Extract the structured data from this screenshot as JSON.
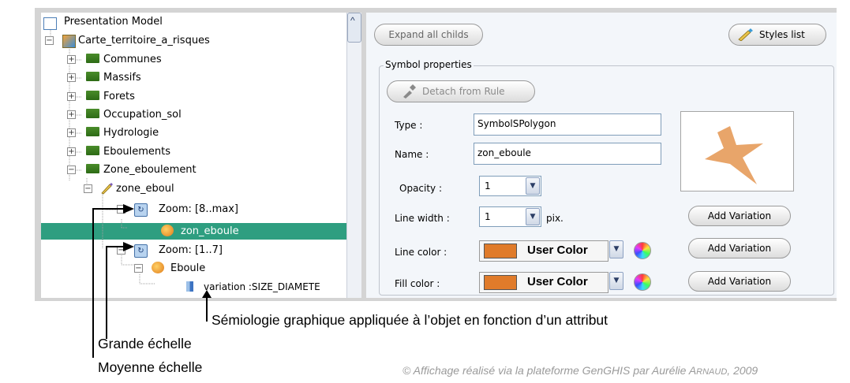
{
  "tree": {
    "items": [
      {
        "label": "Presentation Model",
        "icon": "model-icon"
      },
      {
        "label": "Carte_territoire_a_risques",
        "icon": "map-icon"
      },
      {
        "label": "Communes",
        "icon": "layer-folder-icon"
      },
      {
        "label": "Massifs",
        "icon": "layer-folder-icon"
      },
      {
        "label": "Forets",
        "icon": "layer-folder-icon"
      },
      {
        "label": "Occupation_sol",
        "icon": "layer-folder-icon"
      },
      {
        "label": "Hydrologie",
        "icon": "layer-folder-icon"
      },
      {
        "label": "Eboulements",
        "icon": "layer-folder-icon"
      },
      {
        "label": "Zone_eboulement",
        "icon": "layer-folder-icon"
      },
      {
        "label": "zone_eboul",
        "icon": "style-pen-icon"
      },
      {
        "label": "Zoom: [8..max]",
        "icon": "zoom-rule-icon"
      },
      {
        "label": "zon_eboule",
        "icon": "symbol-icon",
        "selected": true
      },
      {
        "label": "Zoom: [1..7]",
        "icon": "zoom-rule-icon"
      },
      {
        "label": "Eboule",
        "icon": "symbol-icon"
      },
      {
        "label": "variation :SIZE_DIAMETE",
        "icon": "variation-icon"
      }
    ]
  },
  "toolbar": {
    "expand_label": "Expand all childs",
    "styles_label": "Styles list"
  },
  "symbol": {
    "legend": "Symbol properties",
    "detach_label": "Detach from Rule",
    "type_label": "Type :",
    "type_value": "SymbolSPolygon",
    "name_label": "Name :",
    "name_value": "zon_eboule",
    "opacity_label": "Opacity :",
    "opacity_value": "1",
    "linewidth_label": "Line width :",
    "linewidth_value": "1",
    "linewidth_unit": "pix.",
    "linecolor_label": "Line color :",
    "linecolor_value": "User Color",
    "fillcolor_label": "Fill color :",
    "fillcolor_value": "User Color",
    "add_variation_label": "Add Variation",
    "color": "#e07b2a",
    "preview_color": "#e8a56a"
  },
  "annotations": {
    "semiologie": "Sémiologie graphique appliquée à l’objet en fonction d’un attribut",
    "grande": "Grande échelle",
    "moyenne": "Moyenne échelle"
  },
  "credit": {
    "prefix": "© Affichage réalisé via la plateforme GenGHIS par Aurélie ",
    "surname_initial": "A",
    "surname_rest": "RNAUD",
    "suffix": ", 2009"
  }
}
